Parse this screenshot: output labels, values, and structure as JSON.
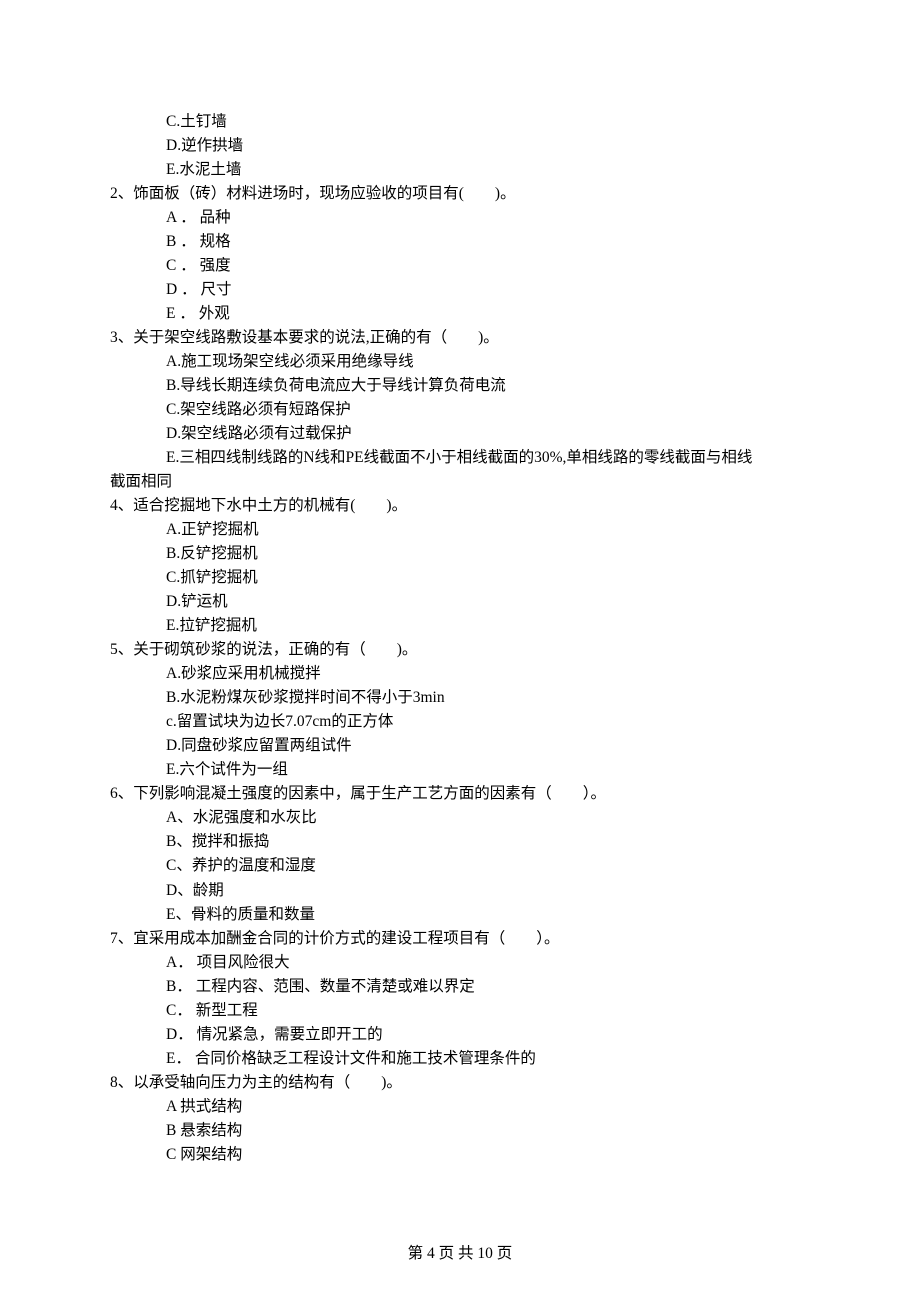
{
  "carryover_opts": [
    "C.土钉墙",
    "D.逆作拱墙",
    "E.水泥土墙"
  ],
  "questions": [
    {
      "stem": "2、饰面板（砖）材料进场时，现场应验收的项目有(　　)。",
      "opts": [
        "A ． 品种",
        "B ． 规格",
        "C ． 强度",
        "D ． 尺寸",
        "E ． 外观"
      ]
    },
    {
      "stem": "3、关于架空线路敷设基本要求的说法,正确的有（　　)。",
      "opts": [
        "A.施工现场架空线必须采用绝缘导线",
        "B.导线长期连续负荷电流应大于导线计算负荷电流",
        "C.架空线路必须有短路保护",
        "D.架空线路必须有过载保护"
      ],
      "wrap_opt_first": "E.三相四线制线路的N线和PE线截面不小于相线截面的30%,单相线路的零线截面与相线",
      "wrap_opt_second": "截面相同"
    },
    {
      "stem": "4、适合挖掘地下水中土方的机械有(　　)。",
      "opts": [
        "A.正铲挖掘机",
        "B.反铲挖掘机",
        "C.抓铲挖掘机",
        "D.铲运机",
        "E.拉铲挖掘机"
      ]
    },
    {
      "stem": "5、关于砌筑砂浆的说法，正确的有（　　)。",
      "opts": [
        "A.砂浆应采用机械搅拌",
        "B.水泥粉煤灰砂浆搅拌时间不得小于3min",
        "c.留置试块为边长7.07cm的正方体",
        "D.同盘砂浆应留置两组试件",
        "E.六个试件为一组"
      ]
    },
    {
      "stem": "6、下列影响混凝土强度的因素中，属于生产工艺方面的因素有（　　）。",
      "opts": [
        "A、水泥强度和水灰比",
        "B、搅拌和振捣",
        "C、养护的温度和湿度",
        "D、龄期",
        "E、骨料的质量和数量"
      ]
    },
    {
      "stem": "7、宜采用成本加酬金合同的计价方式的建设工程项目有（　　）。",
      "opts": [
        "A． 项目风险很大",
        "B． 工程内容、范围、数量不清楚或难以界定",
        "C． 新型工程",
        "D． 情况紧急，需要立即开工的",
        "E． 合同价格缺乏工程设计文件和施工技术管理条件的"
      ]
    },
    {
      "stem": "8、以承受轴向压力为主的结构有（　　)。",
      "opts": [
        "A 拱式结构",
        "B 悬索结构",
        "C 网架结构"
      ]
    }
  ],
  "footer": "第 4 页 共 10 页"
}
